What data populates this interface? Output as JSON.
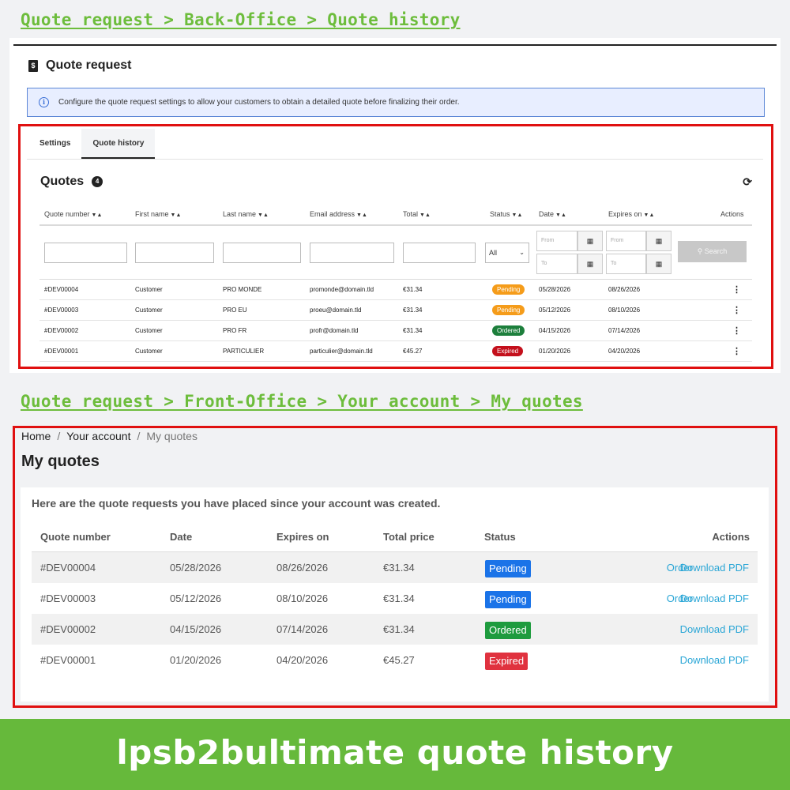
{
  "headings": {
    "back_office": "Quote request > Back-Office > Quote history",
    "front_office": "Quote request > Front-Office > Your account > My quotes"
  },
  "back_office": {
    "page_title": "Quote request",
    "info_text": "Configure the quote request settings to allow your customers to obtain a detailed quote before finalizing their order.",
    "tabs": [
      {
        "label": "Settings",
        "active": false
      },
      {
        "label": "Quote history",
        "active": true
      }
    ],
    "quotes_title": "Quotes",
    "quotes_count": "4",
    "columns": [
      "Quote number",
      "First name",
      "Last name",
      "Email address",
      "Total",
      "Status",
      "Date",
      "Expires on",
      "Actions"
    ],
    "filters": {
      "status_value": "All",
      "from_placeholder": "From",
      "to_placeholder": "To",
      "search_label": "Search"
    },
    "rows": [
      {
        "quote": "#DEV00004",
        "first": "Customer",
        "last": "PRO MONDE",
        "email": "promonde@domain.tld",
        "total": "€31.34",
        "status": "Pending",
        "date": "05/28/2026",
        "expires": "08/26/2026"
      },
      {
        "quote": "#DEV00003",
        "first": "Customer",
        "last": "PRO EU",
        "email": "proeu@domain.tld",
        "total": "€31.34",
        "status": "Pending",
        "date": "05/12/2026",
        "expires": "08/10/2026"
      },
      {
        "quote": "#DEV00002",
        "first": "Customer",
        "last": "PRO FR",
        "email": "profr@domain.tld",
        "total": "€31.34",
        "status": "Ordered",
        "date": "04/15/2026",
        "expires": "07/14/2026"
      },
      {
        "quote": "#DEV00001",
        "first": "Customer",
        "last": "PARTICULIER",
        "email": "particulier@domain.tld",
        "total": "€45.27",
        "status": "Expired",
        "date": "01/20/2026",
        "expires": "04/20/2026"
      }
    ]
  },
  "front_office": {
    "breadcrumb": [
      "Home",
      "Your account",
      "My quotes"
    ],
    "page_title": "My quotes",
    "intro": "Here are the quote requests you have placed since your account was created.",
    "columns": [
      "Quote number",
      "Date",
      "Expires on",
      "Total price",
      "Status",
      "Actions"
    ],
    "rows": [
      {
        "quote": "#DEV00004",
        "date": "05/28/2026",
        "expires": "08/26/2026",
        "total": "€31.34",
        "status": "Pending",
        "order_link": "Order",
        "pdf_link": "Download PDF"
      },
      {
        "quote": "#DEV00003",
        "date": "05/12/2026",
        "expires": "08/10/2026",
        "total": "€31.34",
        "status": "Pending",
        "order_link": "Order",
        "pdf_link": "Download PDF"
      },
      {
        "quote": "#DEV00002",
        "date": "04/15/2026",
        "expires": "07/14/2026",
        "total": "€31.34",
        "status": "Ordered",
        "order_link": "",
        "pdf_link": "Download PDF"
      },
      {
        "quote": "#DEV00001",
        "date": "01/20/2026",
        "expires": "04/20/2026",
        "total": "€45.27",
        "status": "Expired",
        "order_link": "",
        "pdf_link": "Download PDF"
      }
    ]
  },
  "footer_banner": "lpsb2bultimate quote history",
  "colors": {
    "heading_green": "#6dbd3c",
    "banner_green": "#66b93b",
    "frame_red": "#e01010",
    "bo_pending": "#f59c1a",
    "bo_ordered": "#1d7f3c",
    "bo_expired": "#c4101c",
    "fo_pending": "#1a73e8",
    "fo_ordered": "#1e9b3e",
    "fo_expired": "#e0323f",
    "link_blue": "#2aa6d6"
  }
}
